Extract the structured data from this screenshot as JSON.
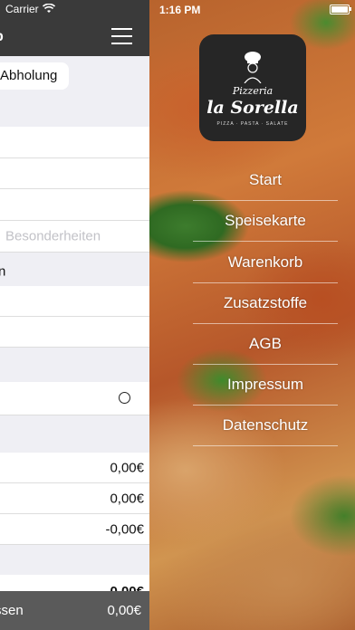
{
  "left_status": {
    "carrier": "Carrier"
  },
  "left_navbar": {
    "title": "b"
  },
  "order_mode": {
    "selected": "Abholung"
  },
  "form": {
    "notes_placeholder": "Besonderheiten",
    "row_n_label": "n"
  },
  "summary": {
    "line1": "0,00€",
    "line2": "0,00€",
    "line3": "-0,00€",
    "total": "0,00€"
  },
  "bottom_bar": {
    "label": "ssen",
    "value": "0,00€"
  },
  "right_status": {
    "time": "1:16 PM"
  },
  "logo": {
    "line1": "Pizzeria",
    "line2": "la Sorella",
    "tagline": "PIZZA · PASTA · SALATE"
  },
  "menu": {
    "items": [
      {
        "label": "Start"
      },
      {
        "label": "Speisekarte"
      },
      {
        "label": "Warenkorb"
      },
      {
        "label": "Zusatzstoffe"
      },
      {
        "label": "AGB"
      },
      {
        "label": "Impressum"
      },
      {
        "label": "Datenschutz"
      }
    ]
  },
  "icons": [
    "wifi-icon",
    "hamburger-menu-icon",
    "radio-icon",
    "battery-icon",
    "chef-icon"
  ]
}
